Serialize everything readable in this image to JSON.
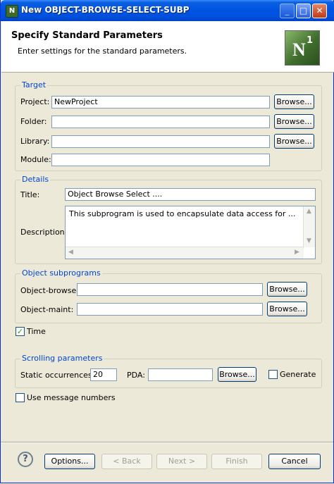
{
  "window": {
    "title": "New OBJECT-BROWSE-SELECT-SUBP",
    "icon": "n1-app-icon"
  },
  "header": {
    "title": "Specify Standard Parameters",
    "subtitle": "Enter settings for the standard parameters.",
    "logo_letter": "N",
    "logo_sup": "1"
  },
  "target": {
    "legend": "Target",
    "project_label": "Project:",
    "project_value": "NewProject",
    "folder_label": "Folder:",
    "folder_value": "",
    "library_label": "Library:",
    "library_value": "",
    "module_label": "Module:",
    "module_value": "",
    "browse_label": "Browse..."
  },
  "details": {
    "legend": "Details",
    "title_label": "Title:",
    "title_value": "Object Browse Select ....",
    "description_label": "Description:",
    "description_value": "This subprogram is used to encapsulate data access for ..."
  },
  "object_subprograms": {
    "legend": "Object subprograms",
    "browse_label": "Object-browse:",
    "browse_value": "",
    "maint_label": "Object-maint:",
    "maint_value": "",
    "browse_button": "Browse..."
  },
  "time": {
    "label": "Time",
    "checked": true
  },
  "scrolling": {
    "legend": "Scrolling parameters",
    "static_label": "Static occurrences:",
    "static_value": "20",
    "pda_label": "PDA:",
    "pda_value": "",
    "browse_button": "Browse...",
    "generate_label": "Generate",
    "generate_checked": false
  },
  "use_message_numbers": {
    "label": "Use message numbers",
    "checked": false
  },
  "footer": {
    "options": "Options...",
    "back": "< Back",
    "next": "Next >",
    "finish": "Finish",
    "cancel": "Cancel"
  },
  "colors": {
    "legend": "#0046D5",
    "titlebar": "#0054E3",
    "dialog_bg": "#ECE9D8"
  }
}
